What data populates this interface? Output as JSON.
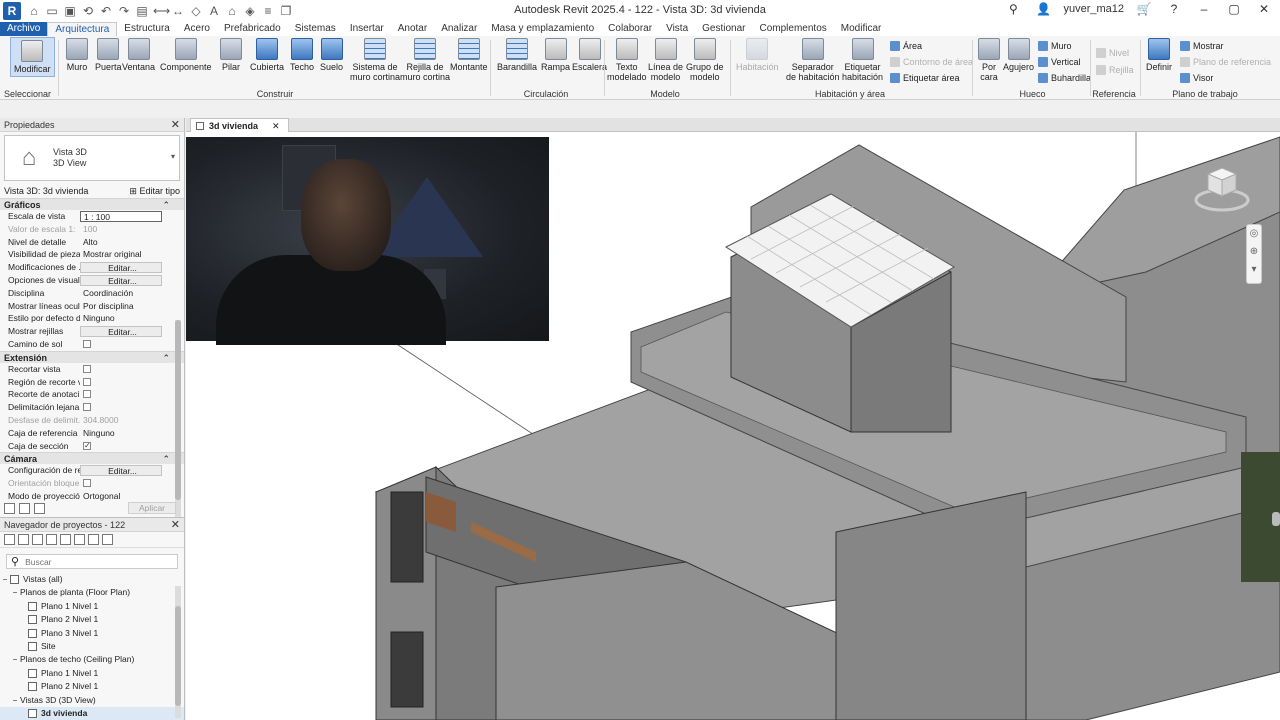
{
  "app": {
    "window_title": "Autodesk Revit 2025.4 - 122 - Vista 3D: 3d vivienda",
    "user": "yuver_ma12"
  },
  "ribbon": {
    "tabs": [
      "Archivo",
      "Arquitectura",
      "Estructura",
      "Acero",
      "Prefabricado",
      "Sistemas",
      "Insertar",
      "Anotar",
      "Analizar",
      "Masa y emplazamiento",
      "Colaborar",
      "Vista",
      "Gestionar",
      "Complementos",
      "Modificar"
    ],
    "active_tab": "Arquitectura",
    "buttons": {
      "modificar": "Modificar",
      "muro": "Muro",
      "puerta": "Puerta",
      "ventana": "Ventana",
      "componente": "Componente",
      "pilar": "Pilar",
      "cubierta": "Cubierta",
      "techo": "Techo",
      "suelo": "Suelo",
      "sistema_muro_1": "Sistema de",
      "sistema_muro_2": "muro cortina",
      "rejilla_muro_1": "Rejilla de",
      "rejilla_muro_2": "muro cortina",
      "montante": "Montante",
      "barandilla": "Barandilla",
      "rampa": "Rampa",
      "escalera": "Escalera",
      "texto_modelado_1": "Texto",
      "texto_modelado_2": "modelado",
      "linea_modelo_1": "Línea de",
      "linea_modelo_2": "modelo",
      "grupo_modelo_1": "Grupo de",
      "grupo_modelo_2": "modelo",
      "habitacion": "Habitación",
      "separador_1": "Separador",
      "separador_2": "de habitación",
      "etiquetar_hab_1": "Etiquetar",
      "etiquetar_hab_2": "habitación",
      "area": "Área",
      "contorno_area": "Contorno de área",
      "etiquetar_area": "Etiquetar área",
      "por_cara_1": "Por",
      "por_cara_2": "cara",
      "agujero": "Agujero",
      "hueco_muro": "Muro",
      "hueco_vertical": "Vertical",
      "buhardilla": "Buhardilla",
      "nivel": "Nivel",
      "rejilla": "Rejilla",
      "definir": "Definir",
      "mostrar": "Mostrar",
      "plano_referencia": "Plano de referencia",
      "visor": "Visor"
    },
    "groups": {
      "seleccionar": "Seleccionar",
      "construir": "Construir",
      "circulacion": "Circulación",
      "modelo": "Modelo",
      "habitacion_area": "Habitación y área",
      "hueco": "Hueco",
      "referencia": "Referencia",
      "plano_trabajo": "Plano de trabajo"
    }
  },
  "properties": {
    "title": "Propiedades",
    "type_line1": "Vista 3D",
    "type_line2": "3D View",
    "view_label": "Vista 3D: 3d vivienda",
    "edit_type": "Editar tipo",
    "categories": {
      "graficos": "Gráficos",
      "extension": "Extensión",
      "camara": "Cámara"
    },
    "rows": {
      "escala_k": "Escala de vista",
      "escala_v": "1 : 100",
      "valor_escala_k": "Valor de escala    1:",
      "valor_escala_v": "100",
      "nivel_detalle_k": "Nivel de detalle",
      "nivel_detalle_v": "Alto",
      "visibilidad_k": "Visibilidad de piezas",
      "visibilidad_v": "Mostrar original",
      "modificaciones_k": "Modificaciones de ...",
      "modificaciones_v": "Editar...",
      "opciones_k": "Opciones de visuali...",
      "opciones_v": "Editar...",
      "disciplina_k": "Disciplina",
      "disciplina_v": "Coordinación",
      "lineas_k": "Mostrar líneas ocult...",
      "lineas_v": "Por disciplina",
      "estilo_k": "Estilo por defecto d...",
      "estilo_v": "Ninguno",
      "rejillas_k": "Mostrar rejillas",
      "rejillas_v": "Editar...",
      "camino_sol_k": "Camino de sol",
      "recortar_k": "Recortar vista",
      "region_k": "Región de recorte v...",
      "recorte_anot_k": "Recorte de anotaci...",
      "delimitacion_k": "Delimitación lejana...",
      "desfase_k": "Desfase de delimit...",
      "desfase_v": "304.8000",
      "caja_ref_k": "Caja de referencia",
      "caja_ref_v": "Ninguno",
      "caja_seccion_k": "Caja de sección",
      "config_k": "Configuración de re...",
      "config_v": "Editar...",
      "orientacion_k": "Orientación bloque...",
      "modo_k": "Modo de proyección",
      "modo_v": "Ortogonal"
    },
    "apply": "Aplicar"
  },
  "browser": {
    "title": "Navegador de proyectos - 122",
    "search_placeholder": "Buscar",
    "tree": {
      "vistas": "Vistas (all)",
      "planos_planta": "Planos de planta (Floor Plan)",
      "pp1": "Plano 1 Nivel 1",
      "pp2": "Plano 2 Nivel 1",
      "pp3": "Plano 3 Nivel 1",
      "site": "Site",
      "planos_techo": "Planos de techo (Ceiling Plan)",
      "pt1": "Plano 1 Nivel 1",
      "pt2": "Plano 2 Nivel 1",
      "vistas3d": "Vistas 3D (3D View)",
      "v3d": "3d vivienda"
    }
  },
  "view": {
    "tab_label": "3d vivienda"
  },
  "colors": {
    "accent": "#1f5fad",
    "model_gray": "#a9a9a9",
    "model_dark": "#7d7d7d"
  }
}
